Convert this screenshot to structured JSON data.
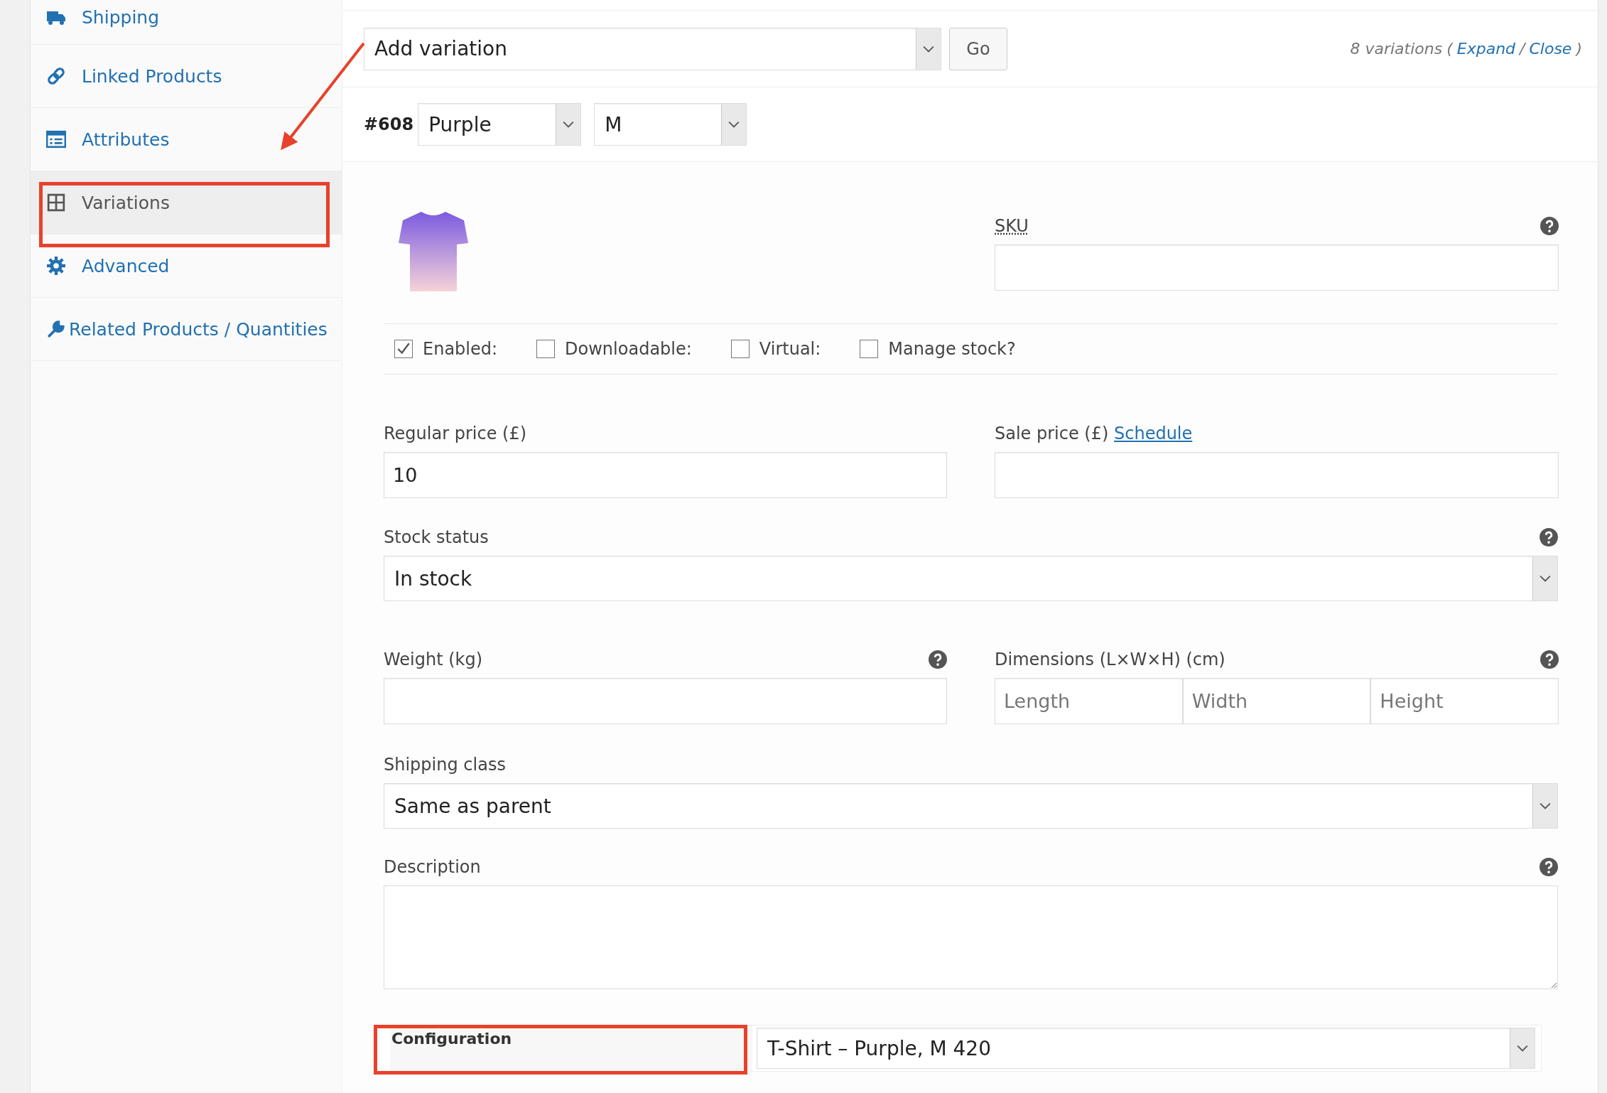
{
  "sidebar": {
    "items": [
      {
        "label": "Shipping",
        "selected": false
      },
      {
        "label": "Linked Products",
        "selected": false
      },
      {
        "label": "Attributes",
        "selected": false
      },
      {
        "label": "Variations",
        "selected": true
      },
      {
        "label": "Advanced",
        "selected": false
      },
      {
        "label": "Related Products / Quantities",
        "selected": false
      }
    ]
  },
  "toolbar": {
    "bulk_action": "Add variation",
    "go_button": "Go",
    "count": "8 variations",
    "open_paren": "(",
    "expand_link": "Expand",
    "separator": "/",
    "close_link": "Close",
    "close_paren": ")"
  },
  "variation": {
    "id": "#608",
    "attributes": [
      "Purple",
      "M"
    ],
    "sku": {
      "label": "SKU"
    },
    "checkboxes": [
      {
        "label": "Enabled:",
        "checked": true
      },
      {
        "label": "Downloadable:",
        "checked": false
      },
      {
        "label": "Virtual:",
        "checked": false
      },
      {
        "label": "Manage stock?",
        "checked": false
      }
    ],
    "regular_price": {
      "label": "Regular price (£)",
      "value": "10"
    },
    "sale_price": {
      "label": "Sale price (£)",
      "link": "Schedule"
    },
    "stock_status": {
      "label": "Stock status",
      "value": "In stock"
    },
    "weight": {
      "label": "Weight (kg)"
    },
    "dimensions": {
      "label": "Dimensions (L×W×H) (cm)",
      "placeholders": [
        "Length",
        "Width",
        "Height"
      ]
    },
    "shipping_class": {
      "label": "Shipping class",
      "value": "Same as parent"
    },
    "description": {
      "label": "Description"
    },
    "configuration": {
      "label": "Configuration",
      "value": "T-Shirt – Purple, M 420"
    }
  }
}
